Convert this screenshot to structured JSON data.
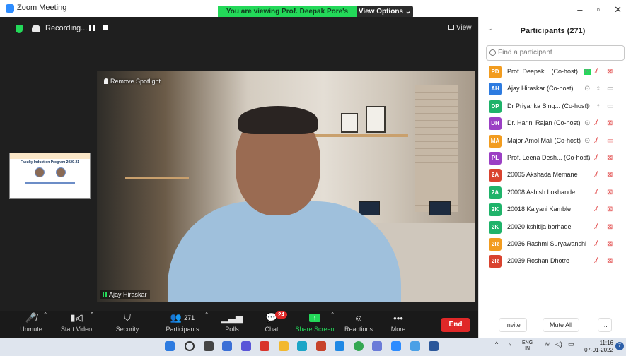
{
  "window": {
    "app_title": "Zoom Meeting",
    "viewing_banner": "You are viewing Prof. Deepak Pore's screen",
    "view_options": "View Options ⌄",
    "controls": [
      "–",
      "▫",
      "✕"
    ]
  },
  "meeting": {
    "recording_label": "Recording...",
    "view_label": "View",
    "spotlight_label": "Remove Spotlight",
    "video_name": "Ajay Hiraskar",
    "shared_thumb_title": "Faculty Induction Program 2020-21"
  },
  "controls": {
    "unmute": "Unmute",
    "start_video": "Start Video",
    "security": "Security",
    "participants": "Participants",
    "participants_count": "271",
    "polls": "Polls",
    "chat": "Chat",
    "chat_badge": "24",
    "share_screen": "Share Screen",
    "reactions": "Reactions",
    "more": "More",
    "end": "End"
  },
  "panel": {
    "title": "Participants (271)",
    "collapse": "⌄",
    "search_placeholder": "Find a participant",
    "participants": [
      {
        "initials": "PD",
        "name": "Prof. Deepak... (Co-host)",
        "color": "#f29c1f",
        "sharing": true,
        "icons": [
          "⊙",
          "⁄̸",
          "⊠"
        ],
        "muted_red": true
      },
      {
        "initials": "AH",
        "name": "Ajay Hiraskar (Co-host)",
        "color": "#2d7be0",
        "sharing": false,
        "icons": [
          "⊙",
          "♀",
          "▭"
        ],
        "muted_red": false
      },
      {
        "initials": "DP",
        "name": "Dr Priyanka Sing... (Co-host)",
        "color": "#1fb36a",
        "sharing": false,
        "icons": [
          "⊙",
          "♀",
          "▭"
        ],
        "muted_red": false
      },
      {
        "initials": "DH",
        "name": "Dr. Harini Rajan (Co-host)",
        "color": "#9b3fc4",
        "sharing": false,
        "icons": [
          "⊙",
          "⁄̸",
          "⊠"
        ],
        "muted_red": true
      },
      {
        "initials": "MA",
        "name": "Major Amol Mali (Co-host)",
        "color": "#f29c1f",
        "sharing": false,
        "icons": [
          "⊙",
          "⁄̸",
          "▭"
        ],
        "muted_red": true
      },
      {
        "initials": "PL",
        "name": "Prof. Leena Desh... (Co-host)",
        "color": "#9b3fc4",
        "sharing": false,
        "icons": [
          "⊙",
          "⁄̸",
          "⊠"
        ],
        "muted_red": true
      },
      {
        "initials": "2A",
        "name": "20005 Akshada Memane",
        "color": "#d9432f",
        "sharing": false,
        "icons": [
          "⁄̸",
          "⊠"
        ],
        "muted_red": true
      },
      {
        "initials": "2A",
        "name": "20008 Ashish Lokhande",
        "color": "#1fb36a",
        "sharing": false,
        "icons": [
          "⁄̸",
          "⊠"
        ],
        "muted_red": true
      },
      {
        "initials": "2K",
        "name": "20018 Kalyani Kamble",
        "color": "#1fb36a",
        "sharing": false,
        "icons": [
          "⁄̸",
          "⊠"
        ],
        "muted_red": true
      },
      {
        "initials": "2K",
        "name": "20020 kshitija borhade",
        "color": "#1fb36a",
        "sharing": false,
        "icons": [
          "⁄̸",
          "⊠"
        ],
        "muted_red": true
      },
      {
        "initials": "2R",
        "name": "20036 Rashmi Suryawanshi",
        "color": "#f29c1f",
        "sharing": false,
        "icons": [
          "⁄̸",
          "⊠"
        ],
        "muted_red": true
      },
      {
        "initials": "2R",
        "name": "20039 Roshan Dhotre",
        "color": "#d9432f",
        "sharing": false,
        "icons": [
          "⁄̸",
          "⊠"
        ],
        "muted_red": true
      }
    ],
    "invite": "Invite",
    "mute_all": "Mute All",
    "more": "..."
  },
  "taskbar": {
    "lang_top": "ENG",
    "lang_bottom": "IN",
    "time": "11:16",
    "date": "07-01-2022",
    "notifications": "7"
  }
}
